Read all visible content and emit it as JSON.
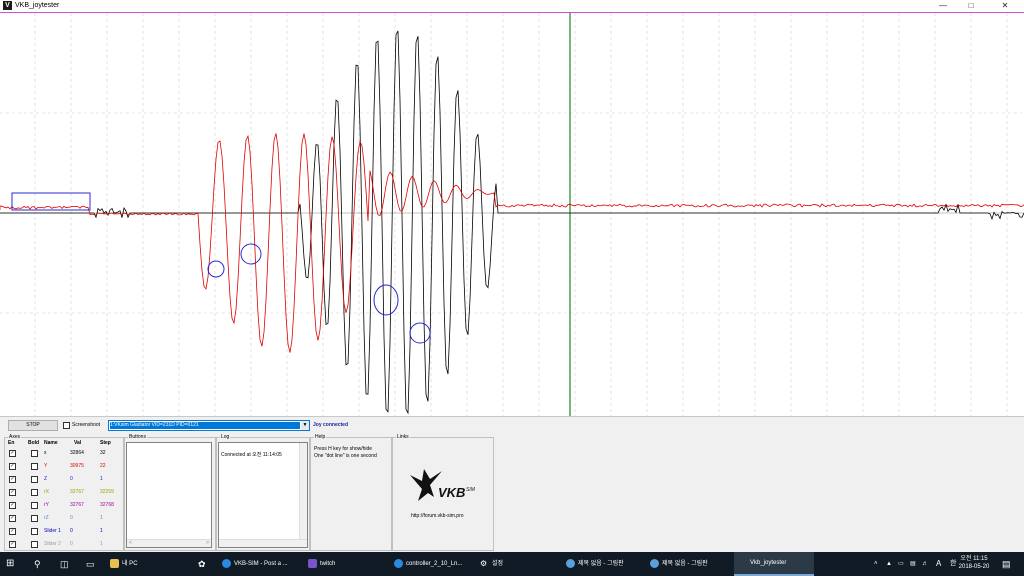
{
  "window": {
    "title": "VKB_joytester"
  },
  "controls": {
    "stop_label": "STOP",
    "screenshot_label": "Screenshoot",
    "device_select": "1:VKsim Gladiator  VID=231D PID=0121",
    "status": "Joy connected"
  },
  "axes": {
    "group_title": "Axes",
    "headers": [
      "En",
      "Bold",
      "Name",
      "Val",
      "Step"
    ],
    "rows": [
      {
        "name": "x",
        "val": "32864",
        "step": "32",
        "color": "#000000"
      },
      {
        "name": "Y",
        "val": "30975",
        "step": "22",
        "color": "#e00000"
      },
      {
        "name": "Z",
        "val": "0",
        "step": "1",
        "color": "#1a1ad0"
      },
      {
        "name": "rX",
        "val": "32767",
        "step": "32259",
        "color": "#a0a000"
      },
      {
        "name": "rY",
        "val": "32767",
        "step": "32768",
        "color": "#a000a0"
      },
      {
        "name": "rZ",
        "val": "0",
        "step": "1",
        "color": "#4a90d0"
      },
      {
        "name": "Slider 1",
        "val": "0",
        "step": "1",
        "color": "#0000c0"
      },
      {
        "name": "Slider 2",
        "val": "0",
        "step": "1",
        "color": "#9a9a9a"
      }
    ]
  },
  "buttons_group": {
    "title": "Buttons"
  },
  "log_group": {
    "title": "Log",
    "text": "Connected at 오전 11:14:05"
  },
  "help_group": {
    "title": "Help",
    "line1": "Press H key for show/hide",
    "line2": "One \"dot line\" is one second"
  },
  "links_group": {
    "title": "Links",
    "logo_text": "VKBSIM",
    "url": "http://forum.vkb-sim.pro"
  },
  "taskbar": {
    "items": [
      {
        "label": "내 PC"
      },
      {
        "label": "VKB-SIM - Post a ..."
      },
      {
        "label": "twitch"
      },
      {
        "label": "controller_2_10_Ln..."
      },
      {
        "label": "설정"
      },
      {
        "label": "제목 없음 - 그림판"
      },
      {
        "label": "제목 없음 - 그림판"
      },
      {
        "label": "Vkb_joytester"
      }
    ],
    "clock_time": "오전 11:15",
    "clock_date": "2018-05-20",
    "ime": "A",
    "lang": "한"
  }
}
